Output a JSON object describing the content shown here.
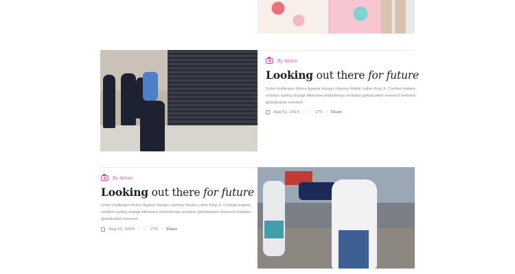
{
  "posts": [
    {
      "category": "By Admin",
      "title_bold": "Looking",
      "title_mid": " out there ",
      "title_italic": "for future",
      "excerpt": "Solve challenges ificiton Against Hunger citizenry Martin Luther King Jr. Combat malaria, mobilize lasting change billionaire philanthropy revitalize globalization research revitalize globalization research.",
      "date": "Aug 02, 2016",
      "likes": "270",
      "share": "Share"
    },
    {
      "category": "By Admin",
      "title_bold": "Looking",
      "title_mid": " out there ",
      "title_italic": "for future",
      "excerpt": "Solve challenges ificiton Against Hunger citizenry Martin Luther King Jr. Combat malaria, mobilize lasting change billionaire philanthropy revitalize globalization research revitalize globalization research.",
      "date": "Aug 02, 2016",
      "likes": "270",
      "share": "Share"
    }
  ],
  "separator": "/",
  "icons": {
    "category": "camera-icon",
    "date": "calendar-icon",
    "likes": "heart-icon"
  },
  "colors": {
    "accent": "#e2429a",
    "title": "#222222",
    "text": "#8a8a8a"
  }
}
